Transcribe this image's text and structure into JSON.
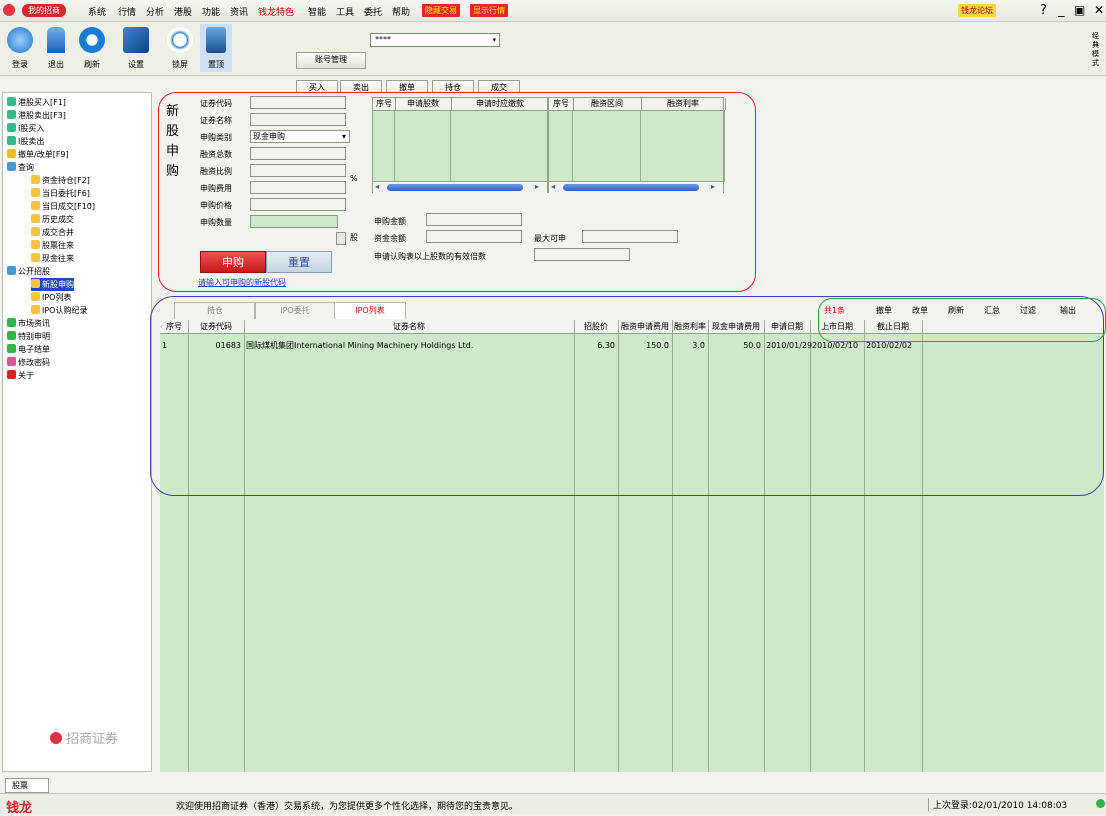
{
  "menubar": {
    "logo": "我的招商",
    "items": [
      "系统",
      "行情",
      "分析",
      "港股",
      "功能",
      "资讯",
      "钱龙特色",
      "智能",
      "工具",
      "委托",
      "帮助"
    ],
    "boxes": [
      "隐藏交易",
      "显示行情"
    ],
    "right_badge": "钱龙论坛"
  },
  "toolbar": {
    "buttons": [
      "登录",
      "退出",
      "刷新",
      "设置",
      "锁屏",
      "置顶"
    ],
    "account_label": "账号管理",
    "account_value": "****",
    "actions": [
      "买入",
      "卖出",
      "撤单",
      "持仓",
      "成交"
    ],
    "side_tag": "经典模式"
  },
  "tree": {
    "items": [
      "港股买入[F1]",
      "港股卖出[F3]",
      "I股买入",
      "I股卖出",
      "撤单/改单[F9]",
      "查询",
      "资金持仓[F2]",
      "当日委托[F6]",
      "当日成交[F10]",
      "历史成交",
      "成交合并",
      "股票往来",
      "现金往来",
      "公开招股",
      "新股申购",
      "IPO列表",
      "IPO认购纪录",
      "市场资讯",
      "特别申明",
      "电子结单",
      "修改密码",
      "关于"
    ]
  },
  "logo_text": "招商证券",
  "form": {
    "side_title": "新股申购",
    "fields": [
      "证券代码",
      "证券名称",
      "申购类别",
      "融资总数",
      "融资比例",
      "申购费用",
      "申购价格",
      "申购数量"
    ],
    "subscribe_type": "现金申购",
    "percent_sign": "%",
    "share_unit": "股",
    "grid1_headers": [
      "序号",
      "申请股数",
      "申请时应缴款"
    ],
    "grid2_headers": [
      "序号",
      "融资区间",
      "融资利率"
    ],
    "amount_label": "申购金额",
    "balance_label": "资金余额",
    "max_label": "最大可申",
    "multiple_label": "申请认购表以上股数的有效倍数",
    "submit_label": "申购",
    "reset_label": "重置",
    "hint_link": "请输入可申购的新股代码"
  },
  "list": {
    "tabs": [
      "持仓",
      "IPO委托",
      "IPO列表"
    ],
    "count": "共1条",
    "actions": [
      "撤单",
      "改单",
      "刷新",
      "汇总",
      "过滤",
      "输出"
    ],
    "headers": [
      "序号",
      "证券代码",
      "证券名称",
      "招股价",
      "融资申请费用",
      "融资利率",
      "现金申请费用",
      "申请日期",
      "上市日期",
      "截止日期"
    ],
    "rows": [
      [
        "1",
        "01683",
        "国际煤机集团International Mining Machinery Holdings Ltd.",
        "6.30",
        "150.0",
        "3.0",
        "50.0",
        "2010/01/29",
        "2010/02/10",
        "2010/02/02"
      ]
    ]
  },
  "bottom_tab": "股票",
  "status": {
    "brand": "钱龙",
    "welcome": "欢迎使用招商证券（香港）交易系统，为您提供更多个性化选择，期待您的宝贵意见。",
    "last_login": "上次登录:02/01/2010 14:08:03"
  },
  "colors": {
    "grid_green": "#cde9c9",
    "red_outline": "#d8252c",
    "blue_outline": "#3f3fb0",
    "green_outline": "#27a33c"
  }
}
